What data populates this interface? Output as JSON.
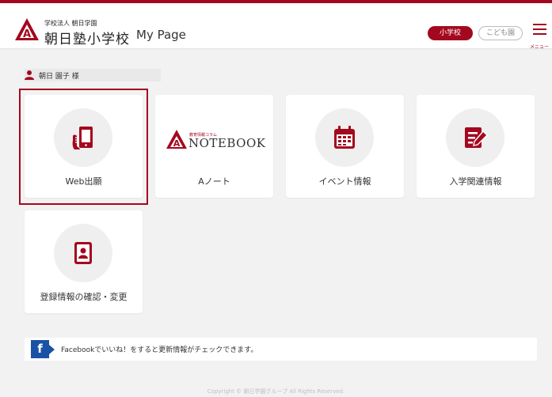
{
  "header": {
    "org_small": "学校法人 朝日学園",
    "org_name": "朝日塾小学校",
    "page_title": "My Page",
    "segment_school": "小学校",
    "segment_kindergarten": "こども園",
    "menu_label": "メニュー"
  },
  "user": {
    "name": "朝日 園子 様"
  },
  "cards": [
    {
      "label": "Web出願",
      "icon": "smartphone-hand-icon",
      "selected": true
    },
    {
      "label": "Aノート",
      "icon": "notebook-logo",
      "logo_small": "教育情報コラム",
      "logo_big": "NOTEBOOK"
    },
    {
      "label": "イベント情報",
      "icon": "calendar-icon"
    },
    {
      "label": "入学関連情報",
      "icon": "edit-document-icon"
    },
    {
      "label": "登録情報の確認・変更",
      "icon": "profile-card-icon"
    }
  ],
  "facebook": {
    "text": "Facebookでいいね！をすると更新情報がチェックできます。"
  },
  "footer": {
    "copyright": "Copyright © 朝日学園グループ All Rights Reserved."
  },
  "colors": {
    "brand": "#a3081f",
    "facebook": "#1a52a5",
    "background": "#f2f2f2"
  }
}
